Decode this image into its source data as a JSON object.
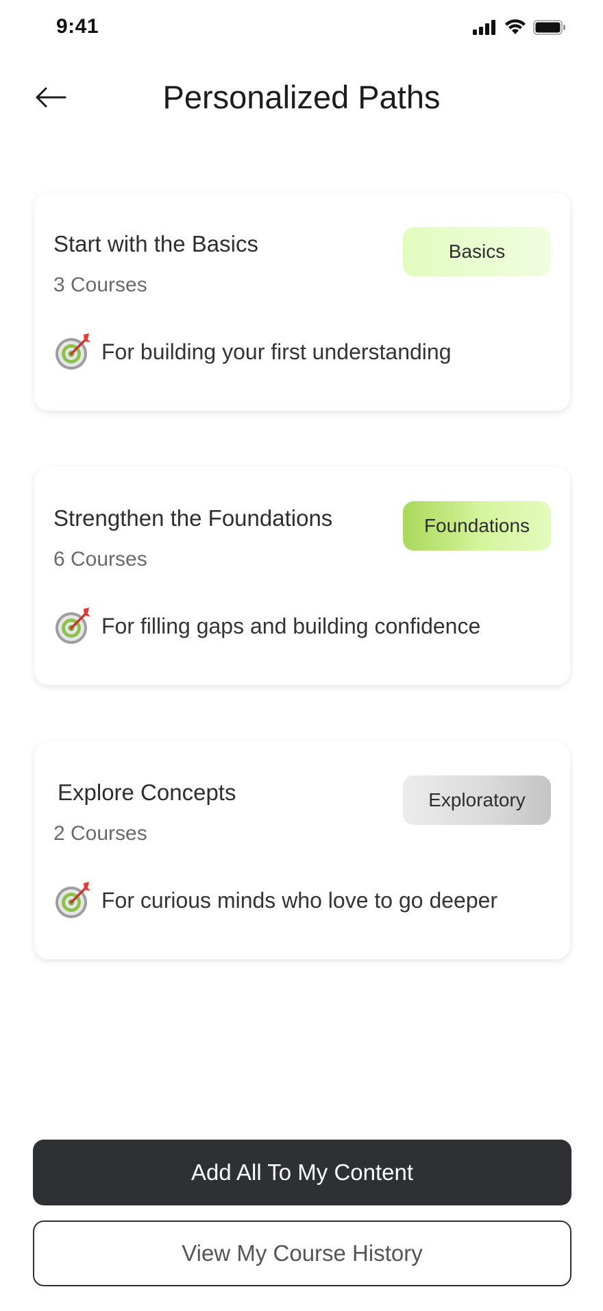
{
  "status_bar": {
    "time": "9:41"
  },
  "header": {
    "title": "Personalized Paths"
  },
  "paths": [
    {
      "title": "Start with the Basics",
      "count": "3 Courses",
      "tag": "Basics",
      "description": "For building your first understanding"
    },
    {
      "title": "Strengthen the Foundations",
      "count": "6 Courses",
      "tag": "Foundations",
      "description": "For filling gaps and building confidence"
    },
    {
      "title": "Explore Concepts",
      "count": "2 Courses",
      "tag": "Exploratory",
      "description": "For curious minds who love to go deeper"
    }
  ],
  "actions": {
    "primary_label": "Add All To My Content",
    "secondary_label": "View My Course History"
  },
  "icons": {
    "back": "arrow-left-icon",
    "path_goal": "target-icon"
  },
  "colors": {
    "primary_button": "#2f3034",
    "tag_basics": "#e1fcbf",
    "tag_foundations": "#a9d85a",
    "tag_exploratory": "#d9d9d9"
  }
}
